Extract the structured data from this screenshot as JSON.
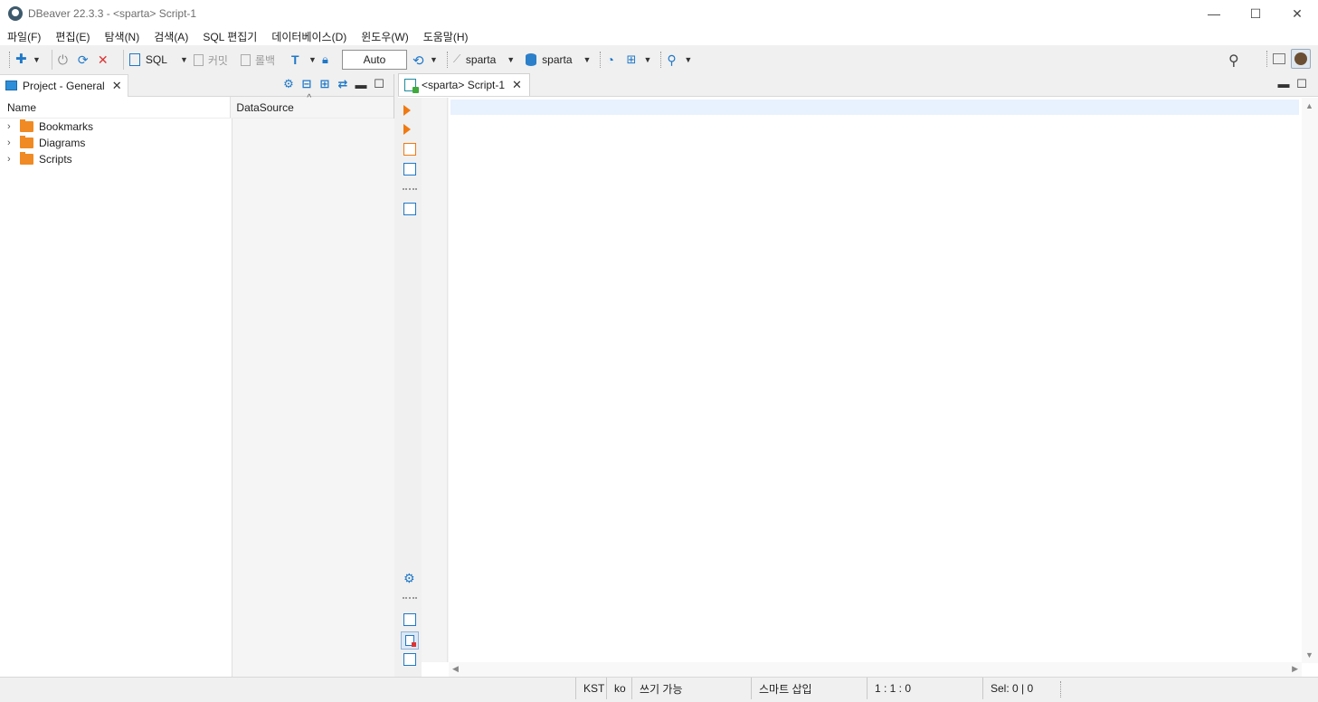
{
  "window": {
    "title": "DBeaver 22.3.3 - <sparta> Script-1",
    "controls": {
      "minimize": "—",
      "maximize": "☐",
      "close": "✕"
    }
  },
  "menu": [
    "파일(F)",
    "편집(E)",
    "탐색(N)",
    "검색(A)",
    "SQL 편집기",
    "데이터베이스(D)",
    "윈도우(W)",
    "도움말(H)"
  ],
  "toolbar": {
    "sql_label": "SQL",
    "commit_label": "커밋",
    "rollback_label": "롤백",
    "transaction_mode": "Auto",
    "datasource": "sparta",
    "schema": "sparta"
  },
  "project_panel": {
    "tab_title": "Project - General",
    "columns": {
      "name": "Name",
      "datasource": "DataSource"
    },
    "items": [
      {
        "label": "Bookmarks",
        "icon": "bookmarks-folder-icon"
      },
      {
        "label": "Diagrams",
        "icon": "diagrams-folder-icon"
      },
      {
        "label": "Scripts",
        "icon": "scripts-folder-icon"
      }
    ]
  },
  "editor": {
    "tab_title": "<sparta> Script-1",
    "content": ""
  },
  "status": {
    "timezone": "KST",
    "locale": "ko",
    "write_mode": "쓰기 가능",
    "insert_mode": "스마트 삽입",
    "cursor_position": "1 : 1 : 0",
    "selection": "Sel: 0 | 0"
  },
  "colors": {
    "accent_blue": "#1f78c8",
    "accent_orange": "#ef7a12",
    "current_line": "#e8f2fe"
  }
}
